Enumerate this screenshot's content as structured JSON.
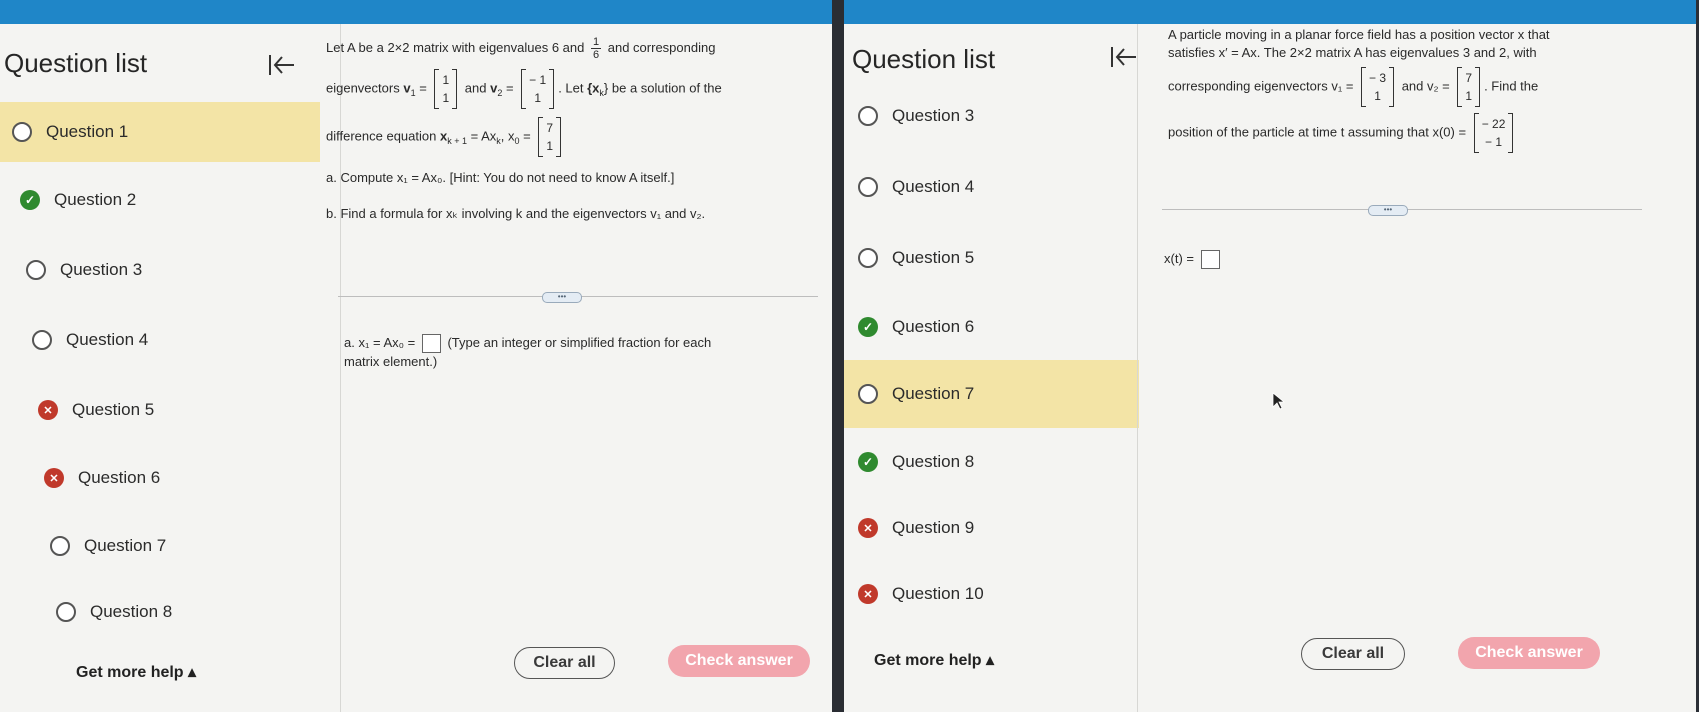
{
  "left": {
    "title": "Question list",
    "collapse_icon": "collapse-left-icon",
    "questions": [
      {
        "label": "Question 1",
        "status": "open",
        "active": true
      },
      {
        "label": "Question 2",
        "status": "done"
      },
      {
        "label": "Question 3",
        "status": "open"
      },
      {
        "label": "Question 4",
        "status": "open"
      },
      {
        "label": "Question 5",
        "status": "wrong"
      },
      {
        "label": "Question 6",
        "status": "wrong"
      },
      {
        "label": "Question 7",
        "status": "open"
      },
      {
        "label": "Question 8",
        "status": "open"
      }
    ],
    "help": "Get more help ▴",
    "problem": {
      "p1a": "Let A be a 2×2 matrix with eigenvalues 6 and",
      "frac_num": "1",
      "frac_den": "6",
      "p1b": "and corresponding",
      "p2a": "eigenvectors",
      "v1": "v",
      "v1_sub": "1",
      "eq": "=",
      "v1_top": "1",
      "v1_bot": "1",
      "and": "and",
      "v2": "v",
      "v2_sub": "2",
      "v2_top": "− 1",
      "v2_bot": "1",
      "p2b": ". Let",
      "xk_set": "{x",
      "xk_sub": "k",
      "xk_close": "}",
      "p2c": "be a solution of the",
      "p3a": "difference equation",
      "p3b": "x",
      "p3b_sub": "k + 1",
      "p3c": "= Ax",
      "p3c_sub": "k",
      "p3d": ", x",
      "p3d_sub": "0",
      "x0_top": "7",
      "x0_bot": "1",
      "a_text": "a. Compute x₁ = Ax₀. [Hint: You do not need to know A itself.]",
      "b_text": "b. Find a formula for xₖ involving k and the eigenvectors v₁ and v₂.",
      "answer_a": "a. x₁ = Ax₀ =",
      "answer_hint": "(Type an integer or simplified fraction for each",
      "answer_hint2": "matrix element.)"
    },
    "clear_label": "Clear all",
    "check_label": "Check answer"
  },
  "right": {
    "title": "Question list",
    "collapse_icon": "collapse-left-icon",
    "questions": [
      {
        "label": "Question 3",
        "status": "open"
      },
      {
        "label": "Question 4",
        "status": "open"
      },
      {
        "label": "Question 5",
        "status": "open"
      },
      {
        "label": "Question 6",
        "status": "done"
      },
      {
        "label": "Question 7",
        "status": "open",
        "active": true
      },
      {
        "label": "Question 8",
        "status": "done"
      },
      {
        "label": "Question 9",
        "status": "wrong"
      },
      {
        "label": "Question 10",
        "status": "wrong"
      }
    ],
    "help": "Get more help ▴",
    "problem": {
      "l1": "A particle moving in a planar force field has a position vector x that",
      "l2": "satisfies x′ = Ax. The 2×2 matrix A has eigenvalues 3 and 2, with",
      "l3a": "corresponding eigenvectors v₁ =",
      "v1_top": "− 3",
      "v1_bot": "1",
      "l3b": "and v₂ =",
      "v2_top": "7",
      "v2_bot": "1",
      "l3c": ". Find the",
      "l4a": "position of the particle at time t assuming that x(0) =",
      "x0_top": "− 22",
      "x0_bot": "− 1",
      "answer": "x(t) ="
    },
    "clear_label": "Clear all",
    "check_label": "Check answer"
  }
}
